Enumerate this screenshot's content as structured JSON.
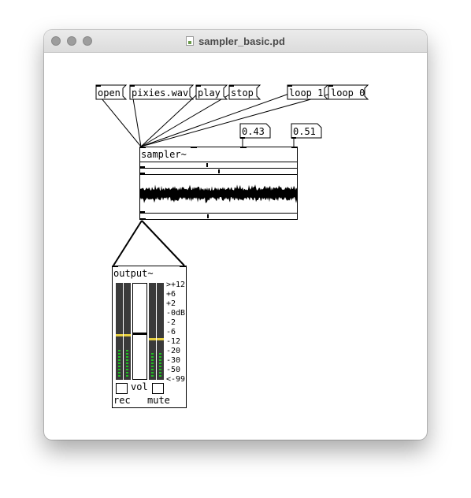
{
  "window": {
    "title": "sampler_basic.pd"
  },
  "messages": {
    "open": "open",
    "file": "pixies.wav",
    "play": "play",
    "stop": "stop",
    "loop1": "loop 1",
    "loop0": "loop 0"
  },
  "numbers": {
    "n1": "0.43",
    "n2": "0.51"
  },
  "sampler": {
    "label": "sampler~"
  },
  "output": {
    "label": "output~",
    "vol_label": "vol",
    "rec_label": "rec",
    "mute_label": "mute",
    "meter_scale": [
      ">+12",
      "+6",
      "+2",
      "-0dB",
      "-2",
      "-6",
      "-12",
      "-20",
      "-30",
      "-50",
      "<-99"
    ]
  },
  "colors": {
    "meter_yellow": "#e8d040",
    "meter_green": "#20c020",
    "meter_bg": "#3a3a3a"
  }
}
